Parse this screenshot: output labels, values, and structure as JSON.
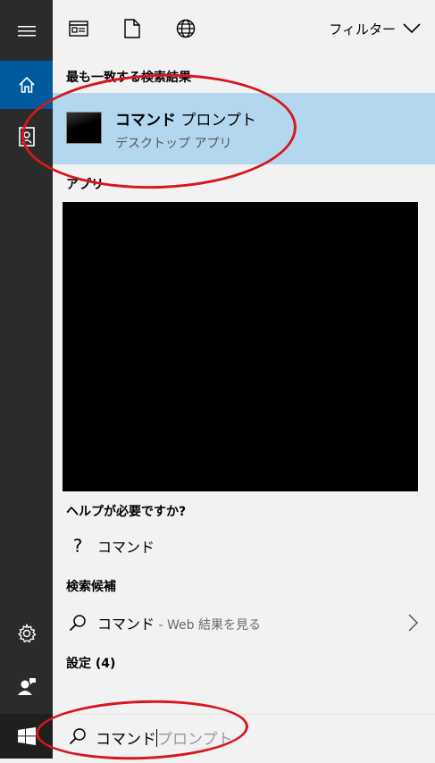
{
  "rail": {
    "menu_icon": "hamburger-icon",
    "home_icon": "home-icon",
    "documents_icon": "contact-card-icon",
    "settings_icon": "gear-icon",
    "feedback_icon": "feedback-user-icon",
    "start_icon": "windows-logo-icon"
  },
  "toolbar": {
    "filter_label": "フィルター"
  },
  "best_match": {
    "section_title": "最も一致する検索結果",
    "title_bold": "コマンド",
    "title_rest": " プロンプト",
    "subtitle": "デスクトップ アプリ"
  },
  "apps": {
    "section_title": "アプリ"
  },
  "help": {
    "section_title": "ヘルプが必要ですか?",
    "item_icon": "?",
    "item_text": "コマンド"
  },
  "suggestions": {
    "section_title": "検索候補",
    "item_text": "コマンド",
    "item_suffix": " - Web 結果を見る"
  },
  "settings": {
    "section_title": "設定 (4)"
  },
  "search": {
    "typed": "コマンド",
    "completion": "プロンプト"
  },
  "colors": {
    "rail": "#2b2b2b",
    "active_rail": "#005a9e",
    "highlight": "#b4d7f0",
    "annotation": "#d8161d"
  }
}
